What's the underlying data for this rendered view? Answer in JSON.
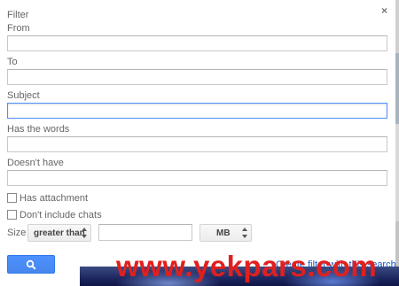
{
  "dialog": {
    "title": "Filter",
    "close_glyph": "×"
  },
  "fields": {
    "from": {
      "label": "From",
      "value": ""
    },
    "to": {
      "label": "To",
      "value": ""
    },
    "subject": {
      "label": "Subject",
      "value": ""
    },
    "has_words": {
      "label": "Has the words",
      "value": ""
    },
    "doesnt_have": {
      "label": "Doesn't have",
      "value": ""
    }
  },
  "checkboxes": {
    "has_attachment": {
      "label": "Has attachment",
      "checked": false
    },
    "dont_include_chats": {
      "label": "Don't include chats",
      "checked": false
    }
  },
  "size": {
    "label": "Size",
    "operator": "greater than",
    "value": "",
    "unit": "MB"
  },
  "actions": {
    "search_icon": "search-icon",
    "create_filter_link": "Create filter with this search »"
  },
  "watermark": "www.yekpars.com",
  "colors": {
    "focus_border": "#4d90fe",
    "button_blue": "#4d90fe",
    "link_blue": "#1155cc",
    "watermark_red": "#e0201e"
  }
}
